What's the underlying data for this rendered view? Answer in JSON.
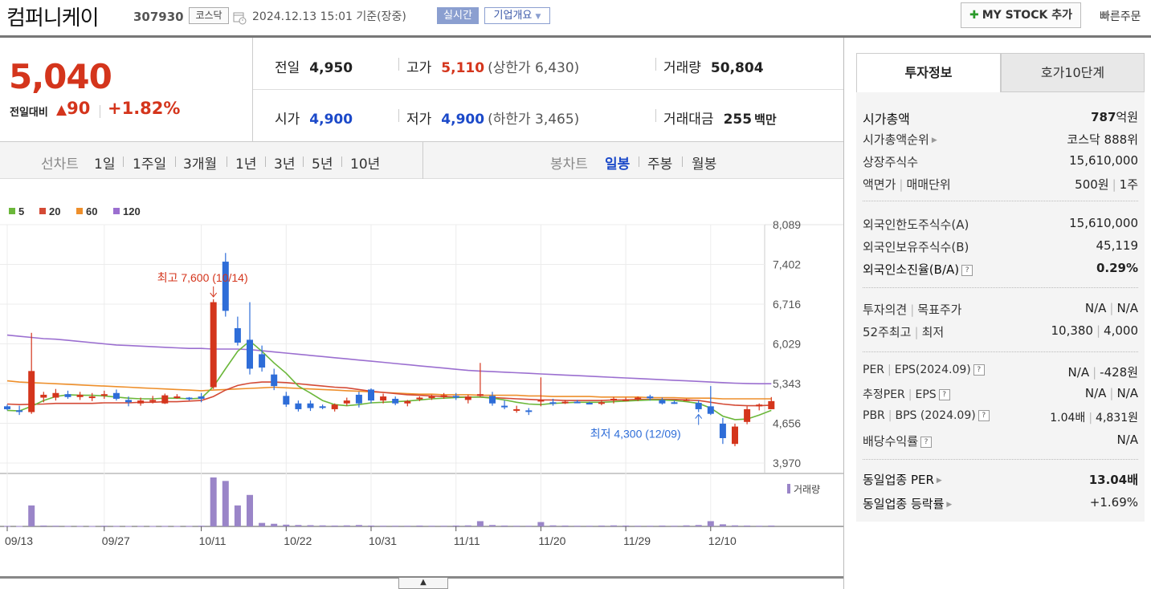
{
  "header": {
    "name": "컴퍼니케이",
    "code": "307930",
    "market": "코스닥",
    "datetime": "2024.12.13 15:01",
    "basis": "기준(장중)",
    "realtime_label": "실시간",
    "company_overview_label": "기업개요",
    "mystock_label": "MY STOCK 추가",
    "quick_order_label": "빠른주문"
  },
  "price": {
    "current": "5,040",
    "change_label": "전일대비",
    "change": "90",
    "change_pct": "+1.82%",
    "prev_close_label": "전일",
    "prev_close": "4,950",
    "open_label": "시가",
    "open": "4,900",
    "high_label": "고가",
    "high": "5,110",
    "upper_limit": "(상한가 6,430)",
    "low_label": "저가",
    "low": "4,900",
    "lower_limit": "(하한가 3,465)",
    "volume_label": "거래량",
    "volume": "50,804",
    "amount_label": "거래대금",
    "amount": "255",
    "amount_unit": "백만"
  },
  "tabs": {
    "line_chart": "선차트",
    "periods": [
      "1일",
      "1주일",
      "3개월",
      "1년",
      "3년",
      "5년",
      "10년"
    ],
    "candle_chart": "봉차트",
    "candles": [
      "일봉",
      "주봉",
      "월봉"
    ]
  },
  "chart_data": {
    "type": "candlestick",
    "legend": [
      "5",
      "20",
      "60",
      "120"
    ],
    "ma_colors": {
      "5": "#6bb73a",
      "20": "#d44a35",
      "60": "#ee8f2b",
      "120": "#9b6fd0"
    },
    "up_color": "#d4351c",
    "down_color": "#2e6dd8",
    "y_ticks": [
      "8,089",
      "7,402",
      "6,716",
      "6,029",
      "5,343",
      "4,656",
      "3,970"
    ],
    "y_tick_values": [
      8089,
      7402,
      6716,
      6029,
      5343,
      4656,
      3970
    ],
    "ylim": [
      3970,
      8089
    ],
    "x_ticks": [
      "09/13",
      "09/27",
      "10/11",
      "10/22",
      "10/31",
      "11/11",
      "11/20",
      "11/29",
      "12/10"
    ],
    "x_tick_index": [
      0,
      8,
      16,
      23,
      30,
      37,
      44,
      51,
      58
    ],
    "high_annotation": "최고 7,600 (10/14)",
    "low_annotation": "최저 4,300 (12/09)",
    "high_marker_index": 17,
    "low_marker_index": 57,
    "candles": [
      [
        4950,
        4980,
        4880,
        4900
      ],
      [
        4880,
        4960,
        4800,
        4860
      ],
      [
        4850,
        6220,
        4820,
        5560
      ],
      [
        5100,
        5200,
        5020,
        5150
      ],
      [
        5100,
        5250,
        5050,
        5180
      ],
      [
        5160,
        5220,
        5080,
        5110
      ],
      [
        5110,
        5200,
        5060,
        5150
      ],
      [
        5100,
        5180,
        5040,
        5120
      ],
      [
        5150,
        5220,
        5080,
        5160
      ],
      [
        5180,
        5240,
        5050,
        5080
      ],
      [
        5060,
        5120,
        4950,
        5020
      ],
      [
        5000,
        5100,
        4960,
        5050
      ],
      [
        5040,
        5130,
        5000,
        5060
      ],
      [
        5000,
        5170,
        4990,
        5140
      ],
      [
        5100,
        5160,
        5080,
        5120
      ],
      [
        5100,
        5110,
        5050,
        5080
      ],
      [
        5120,
        5180,
        5020,
        5080
      ],
      [
        5280,
        6800,
        5250,
        6750
      ],
      [
        7450,
        7600,
        6500,
        6600
      ],
      [
        6300,
        6500,
        6000,
        6050
      ],
      [
        6100,
        6750,
        5500,
        5600
      ],
      [
        5850,
        6000,
        5550,
        5620
      ],
      [
        5500,
        5600,
        5230,
        5300
      ],
      [
        5130,
        5200,
        4940,
        4980
      ],
      [
        5000,
        5050,
        4860,
        4900
      ],
      [
        5000,
        5050,
        4870,
        4920
      ],
      [
        4950,
        4980,
        4900,
        4930
      ],
      [
        4900,
        5000,
        4860,
        4980
      ],
      [
        5000,
        5100,
        4960,
        5050
      ],
      [
        5150,
        5200,
        4930,
        5000
      ],
      [
        5240,
        5260,
        5000,
        5050
      ],
      [
        5050,
        5170,
        5000,
        5120
      ],
      [
        5080,
        5120,
        4970,
        5000
      ],
      [
        5000,
        5060,
        4950,
        5040
      ],
      [
        5080,
        5120,
        5040,
        5100
      ],
      [
        5100,
        5150,
        5060,
        5120
      ],
      [
        5110,
        5180,
        5080,
        5140
      ],
      [
        5130,
        5180,
        5060,
        5100
      ],
      [
        5060,
        5150,
        5000,
        5120
      ],
      [
        5130,
        5700,
        5110,
        5160
      ],
      [
        5130,
        5200,
        4960,
        5000
      ],
      [
        4960,
        5050,
        4900,
        4940
      ],
      [
        4890,
        4960,
        4840,
        4900
      ],
      [
        4880,
        4920,
        4800,
        4860
      ],
      [
        5040,
        5450,
        4950,
        5060
      ],
      [
        5020,
        5080,
        4960,
        5000
      ],
      [
        5020,
        5060,
        4990,
        5030
      ],
      [
        5030,
        5060,
        5010,
        5020
      ],
      [
        5010,
        5030,
        4990,
        5000
      ],
      [
        5000,
        5060,
        4970,
        5020
      ],
      [
        5050,
        5110,
        5000,
        5080
      ],
      [
        5060,
        5100,
        5040,
        5070
      ],
      [
        5070,
        5120,
        5040,
        5100
      ],
      [
        5120,
        5150,
        5050,
        5090
      ],
      [
        5060,
        5100,
        4980,
        5000
      ],
      [
        5020,
        5050,
        4990,
        5010
      ],
      [
        5050,
        5080,
        5040,
        5070
      ],
      [
        5010,
        5050,
        4850,
        4900
      ],
      [
        4950,
        5300,
        4800,
        4820
      ],
      [
        4650,
        4750,
        4300,
        4400
      ],
      [
        4300,
        4650,
        4260,
        4600
      ],
      [
        4680,
        4950,
        4640,
        4900
      ],
      [
        4950,
        5000,
        4880,
        4980
      ],
      [
        4900,
        5110,
        4900,
        5040
      ]
    ],
    "ma5": [
      4880,
      4870,
      4950,
      5050,
      5120,
      5150,
      5140,
      5140,
      5130,
      5110,
      5090,
      5080,
      5080,
      5090,
      5090,
      5080,
      5090,
      5290,
      5600,
      5900,
      6080,
      5900,
      5700,
      5520,
      5300,
      5180,
      5050,
      4980,
      4960,
      4980,
      5010,
      5020,
      5030,
      5040,
      5060,
      5080,
      5090,
      5100,
      5110,
      5110,
      5090,
      5060,
      5020,
      4990,
      4980,
      5000,
      5010,
      5020,
      5020,
      5020,
      5030,
      5040,
      5050,
      5060,
      5060,
      5050,
      5030,
      5000,
      4920,
      4780,
      4720,
      4730,
      4800,
      4880
    ],
    "ma20": [
      4990,
      4980,
      4985,
      4990,
      5000,
      5000,
      5000,
      5000,
      5010,
      5010,
      5010,
      5020,
      5020,
      5030,
      5030,
      5040,
      5050,
      5120,
      5230,
      5310,
      5350,
      5370,
      5370,
      5360,
      5340,
      5320,
      5300,
      5280,
      5270,
      5240,
      5210,
      5190,
      5170,
      5150,
      5140,
      5130,
      5120,
      5110,
      5110,
      5110,
      5100,
      5090,
      5080,
      5070,
      5060,
      5060,
      5050,
      5050,
      5050,
      5050,
      5060,
      5060,
      5070,
      5070,
      5070,
      5070,
      5060,
      5050,
      5020,
      4990,
      4970,
      4960,
      4960,
      4970
    ],
    "ma60": [
      5390,
      5370,
      5360,
      5350,
      5340,
      5330,
      5320,
      5310,
      5300,
      5290,
      5280,
      5270,
      5260,
      5250,
      5240,
      5230,
      5220,
      5230,
      5240,
      5250,
      5260,
      5270,
      5280,
      5270,
      5260,
      5250,
      5240,
      5230,
      5220,
      5210,
      5200,
      5190,
      5180,
      5170,
      5160,
      5160,
      5150,
      5150,
      5150,
      5140,
      5140,
      5140,
      5140,
      5130,
      5130,
      5120,
      5120,
      5120,
      5120,
      5110,
      5110,
      5110,
      5110,
      5100,
      5100,
      5100,
      5090,
      5090,
      5090,
      5080,
      5080,
      5080,
      5080,
      5080
    ],
    "ma120": [
      6180,
      6160,
      6140,
      6120,
      6110,
      6090,
      6070,
      6050,
      6030,
      6010,
      6000,
      5990,
      5980,
      5970,
      5960,
      5950,
      5950,
      5940,
      5940,
      5940,
      5930,
      5910,
      5890,
      5870,
      5850,
      5830,
      5810,
      5790,
      5770,
      5750,
      5730,
      5710,
      5690,
      5670,
      5650,
      5630,
      5610,
      5590,
      5570,
      5560,
      5550,
      5540,
      5530,
      5520,
      5510,
      5500,
      5490,
      5480,
      5470,
      5460,
      5450,
      5440,
      5430,
      5420,
      5410,
      5400,
      5390,
      5380,
      5370,
      5360,
      5350,
      5345,
      5340,
      5340
    ],
    "volume_label": "거래량",
    "volume": [
      3,
      2,
      120,
      5,
      4,
      3,
      3,
      2,
      4,
      3,
      2,
      3,
      2,
      3,
      2,
      3,
      4,
      280,
      260,
      120,
      180,
      20,
      15,
      10,
      8,
      7,
      6,
      5,
      6,
      8,
      5,
      4,
      4,
      4,
      5,
      4,
      4,
      5,
      6,
      30,
      8,
      5,
      4,
      4,
      25,
      6,
      5,
      4,
      4,
      5,
      6,
      5,
      4,
      4,
      5,
      4,
      6,
      8,
      30,
      12,
      6,
      5,
      4,
      5
    ]
  },
  "panel": {
    "tab_invest": "투자정보",
    "tab_quote": "호가10단계",
    "market_cap_label": "시가총액",
    "market_cap": "787",
    "market_cap_unit": "억원",
    "market_cap_rank_label": "시가총액순위",
    "market_cap_rank": "코스닥 888위",
    "shares_label": "상장주식수",
    "shares": "15,610,000",
    "face_label": "액면가",
    "lot_label": "매매단위",
    "face": "500원",
    "lot": "1주",
    "foreign_limit_label": "외국인한도주식수(A)",
    "foreign_limit": "15,610,000",
    "foreign_hold_label": "외국인보유주식수(B)",
    "foreign_hold": "45,119",
    "foreign_rate_label": "외국인소진율(B/A)",
    "foreign_rate": "0.29%",
    "opinion_label": "투자의견",
    "target_label": "목표주가",
    "opinion": "N/A",
    "target": "N/A",
    "w52_high_label": "52주최고",
    "w52_low_label": "최저",
    "w52_high": "10,380",
    "w52_low": "4,000",
    "per_label": "PER",
    "eps_label": "EPS(2024.09)",
    "per": "N/A",
    "eps": "-428원",
    "est_per_label": "추정PER",
    "est_eps_label": "EPS",
    "est_per": "N/A",
    "est_eps": "N/A",
    "pbr_label": "PBR",
    "bps_label": "BPS (2024.09)",
    "pbr": "1.04배",
    "bps": "4,831원",
    "div_label": "배당수익률",
    "div": "N/A",
    "ind_per_label": "동일업종 PER",
    "ind_per": "13.04",
    "ind_per_unit": "배",
    "ind_chg_label": "동일업종 등락률",
    "ind_chg": "+1.69%"
  }
}
